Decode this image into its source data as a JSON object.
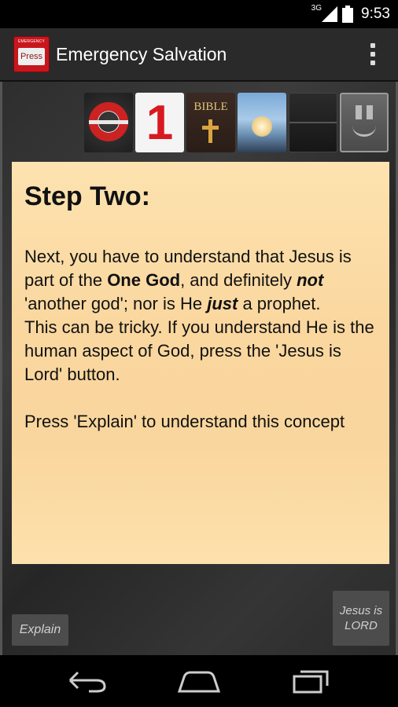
{
  "status_bar": {
    "network": "3G",
    "time": "9:53"
  },
  "action_bar": {
    "icon_top_text": "EMERGENCY",
    "icon_button_text": "Press",
    "title": "Emergency Salvation"
  },
  "toolbar_icons": [
    {
      "name": "lifebuoy-icon"
    },
    {
      "name": "number-one-icon",
      "text": "1"
    },
    {
      "name": "bible-icon",
      "text": "BIBLE"
    },
    {
      "name": "heaven-sky-icon"
    },
    {
      "name": "dark-tile-icon"
    },
    {
      "name": "pause-smile-icon"
    }
  ],
  "note": {
    "heading": "Step Two:",
    "line1_a": "Next, you have to understand that Jesus is part of the ",
    "line1_bold": "One God",
    "line1_b": ", and definitely ",
    "line1_not": "not",
    "line1_c": " 'another god'; nor is He ",
    "line1_just": "just",
    "line1_d": " a prophet.",
    "line2": "This can be tricky. If you understand He is the human aspect of God, press the 'Jesus is Lord' button.",
    "line3": "Press 'Explain' to understand this concept"
  },
  "buttons": {
    "explain": "Explain",
    "jesus_is_lord": "Jesus is LORD"
  },
  "colors": {
    "note_bg": "#fad79f",
    "accent_red": "#d8191f"
  }
}
